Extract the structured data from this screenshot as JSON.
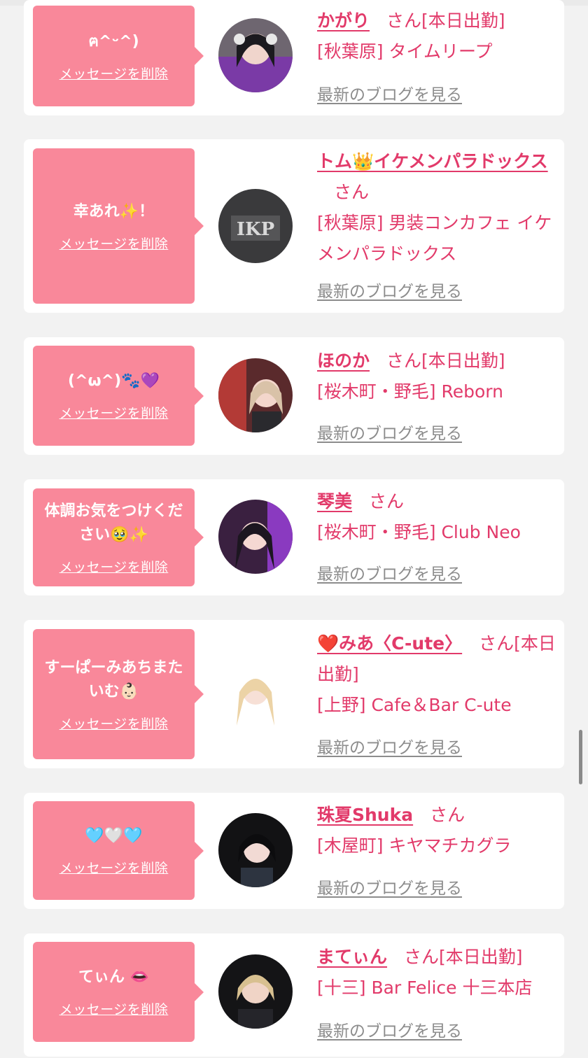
{
  "cards": [
    {
      "message": "ฅ^ᵕ^)",
      "delete_label": "メッセージを削除",
      "name": "かがり",
      "san": "さん",
      "status": "[本日出勤]",
      "shop": "[秋葉原] タイムリープ",
      "blog_label": "最新のブログを見る"
    },
    {
      "message": "幸あれ✨！",
      "delete_label": "メッセージを削除",
      "name": "トム👑イケメンパラドックス",
      "san": "さん",
      "status": "",
      "shop": "[秋葉原] 男装コンカフェ イケメンパラドックス",
      "avatar_text": "IKP",
      "blog_label": "最新のブログを見る"
    },
    {
      "message": "(^ω^)🐾💜",
      "delete_label": "メッセージを削除",
      "name": "ほのか",
      "san": "さん",
      "status": "[本日出勤]",
      "shop": "[桜木町・野毛] Reborn",
      "blog_label": "最新のブログを見る"
    },
    {
      "message": "体調お気をつけください🥹✨",
      "delete_label": "メッセージを削除",
      "name": "琴美",
      "san": "さん",
      "status": "",
      "shop": "[桜木町・野毛] Club Neo",
      "blog_label": "最新のブログを見る"
    },
    {
      "message": "すーぱーみあちまたいむ👶🏻",
      "delete_label": "メッセージを削除",
      "name": "❤️みあ〈C-ute〉",
      "san": "さん",
      "status": "[本日出勤]",
      "shop": "[上野] Cafe＆Bar C-ute",
      "blog_label": "最新のブログを見る"
    },
    {
      "message": "🩵🤍🩵",
      "delete_label": "メッセージを削除",
      "name": "珠夏Shuka",
      "san": "さん",
      "status": "",
      "shop": "[木屋町] キヤマチカグラ",
      "blog_label": "最新のブログを見る"
    },
    {
      "message": "てぃん 👄",
      "delete_label": "メッセージを削除",
      "name": "まてぃん",
      "san": "さん",
      "status": "[本日出勤]",
      "shop": "[十三] Bar Felice 十三本店",
      "blog_label": "最新のブログを見る"
    }
  ],
  "colors": {
    "bubble": "#f9889a",
    "accent": "#e23a6a",
    "link_gray": "#8c8c8c"
  }
}
